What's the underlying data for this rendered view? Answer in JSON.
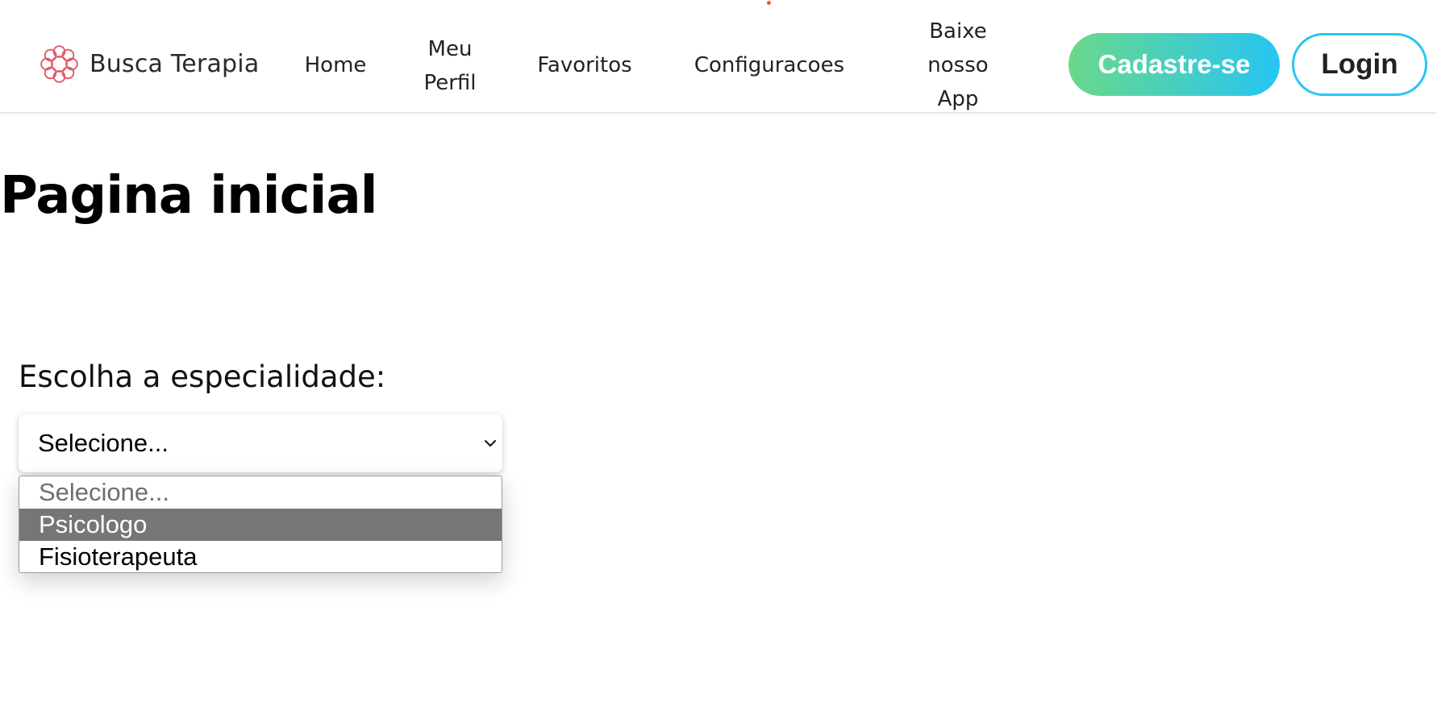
{
  "brand": {
    "name": "Busca Terapia",
    "logo_icon": "flower-logo-icon",
    "logo_color": "#e05a68"
  },
  "nav": {
    "home": "Home",
    "perfil": "Meu Perfil",
    "favoritos": "Favoritos",
    "configuracoes": "Configuracoes",
    "app": "Baixe nosso App"
  },
  "actions": {
    "cadastro": "Cadastre-se",
    "login": "Login",
    "gradient_start": "#6ad88a",
    "gradient_end": "#26c5f3"
  },
  "main": {
    "title": "Pagina inicial",
    "label": "Escolha a especialidade:",
    "select": {
      "value": "Selecione...",
      "options": [
        "Selecione...",
        "Psicologo",
        "Fisioterapeuta"
      ],
      "highlighted": "Psicologo"
    }
  }
}
